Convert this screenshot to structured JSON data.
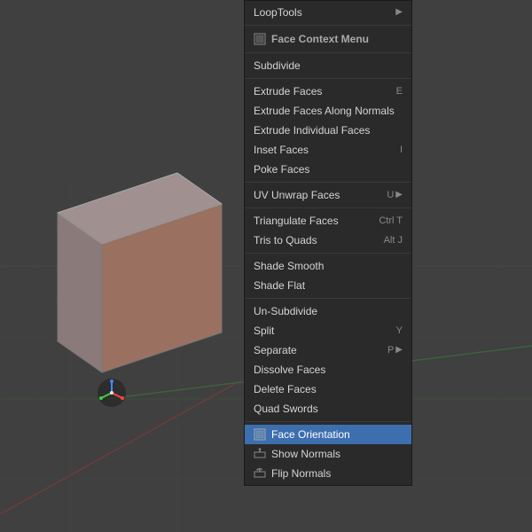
{
  "viewport": {
    "background_color": "#404040",
    "grid_color": "#4a4a4a"
  },
  "context_menu": {
    "title": "Face Context Menu",
    "items": [
      {
        "id": "loop-tools",
        "label": "LoopTools",
        "shortcut": "",
        "arrow": "▶",
        "separator_before": false,
        "separator_after": false,
        "type": "submenu"
      },
      {
        "id": "face-context-menu-header",
        "label": "Face Context Menu",
        "shortcut": "",
        "arrow": "",
        "separator_before": false,
        "separator_after": false,
        "type": "header"
      },
      {
        "id": "subdivide",
        "label": "Subdivide",
        "shortcut": "",
        "arrow": "",
        "separator_before": true,
        "separator_after": false,
        "type": "action"
      },
      {
        "id": "extrude-faces",
        "label": "Extrude Faces",
        "shortcut": "E",
        "arrow": "",
        "separator_before": true,
        "separator_after": false,
        "type": "action"
      },
      {
        "id": "extrude-faces-along-normals",
        "label": "Extrude Faces Along Normals",
        "shortcut": "",
        "arrow": "",
        "separator_before": false,
        "separator_after": false,
        "type": "action"
      },
      {
        "id": "extrude-individual-faces",
        "label": "Extrude Individual Faces",
        "shortcut": "",
        "arrow": "",
        "separator_before": false,
        "separator_after": false,
        "type": "action"
      },
      {
        "id": "inset-faces",
        "label": "Inset Faces",
        "shortcut": "I",
        "arrow": "",
        "separator_before": false,
        "separator_after": false,
        "type": "action"
      },
      {
        "id": "poke-faces",
        "label": "Poke Faces",
        "shortcut": "",
        "arrow": "",
        "separator_before": false,
        "separator_after": false,
        "type": "action"
      },
      {
        "id": "uv-unwrap-faces",
        "label": "UV Unwrap Faces",
        "shortcut": "U",
        "arrow": "▶",
        "separator_before": true,
        "separator_after": false,
        "type": "submenu"
      },
      {
        "id": "triangulate-faces",
        "label": "Triangulate Faces",
        "shortcut": "Ctrl T",
        "arrow": "",
        "separator_before": true,
        "separator_after": false,
        "type": "action"
      },
      {
        "id": "tris-to-quads",
        "label": "Tris to Quads",
        "shortcut": "Alt J",
        "arrow": "",
        "separator_before": false,
        "separator_after": false,
        "type": "action"
      },
      {
        "id": "shade-smooth",
        "label": "Shade Smooth",
        "shortcut": "",
        "arrow": "",
        "separator_before": true,
        "separator_after": false,
        "type": "action"
      },
      {
        "id": "shade-flat",
        "label": "Shade Flat",
        "shortcut": "",
        "arrow": "",
        "separator_before": false,
        "separator_after": false,
        "type": "action"
      },
      {
        "id": "un-subdivide",
        "label": "Un-Subdivide",
        "shortcut": "",
        "arrow": "",
        "separator_before": true,
        "separator_after": false,
        "type": "action"
      },
      {
        "id": "split",
        "label": "Split",
        "shortcut": "Y",
        "arrow": "",
        "separator_before": false,
        "separator_after": false,
        "type": "action"
      },
      {
        "id": "separate",
        "label": "Separate",
        "shortcut": "P",
        "arrow": "▶",
        "separator_before": false,
        "separator_after": false,
        "type": "submenu"
      },
      {
        "id": "dissolve-faces",
        "label": "Dissolve Faces",
        "shortcut": "",
        "arrow": "",
        "separator_before": false,
        "separator_after": false,
        "type": "action"
      },
      {
        "id": "delete-faces",
        "label": "Delete Faces",
        "shortcut": "",
        "arrow": "",
        "separator_before": false,
        "separator_after": false,
        "type": "action"
      },
      {
        "id": "quad-swords",
        "label": "Quad Swords",
        "shortcut": "",
        "arrow": "",
        "separator_before": false,
        "separator_after": false,
        "type": "action"
      },
      {
        "id": "face-orientation",
        "label": "Face  Orientation",
        "shortcut": "",
        "arrow": "",
        "separator_before": true,
        "separator_after": false,
        "type": "action",
        "highlighted": true
      },
      {
        "id": "show-normals",
        "label": "Show Normals",
        "shortcut": "",
        "arrow": "",
        "separator_before": false,
        "separator_after": false,
        "type": "action"
      },
      {
        "id": "flip-normals",
        "label": "Flip Normals",
        "shortcut": "",
        "arrow": "",
        "separator_before": false,
        "separator_after": false,
        "type": "action"
      }
    ]
  }
}
